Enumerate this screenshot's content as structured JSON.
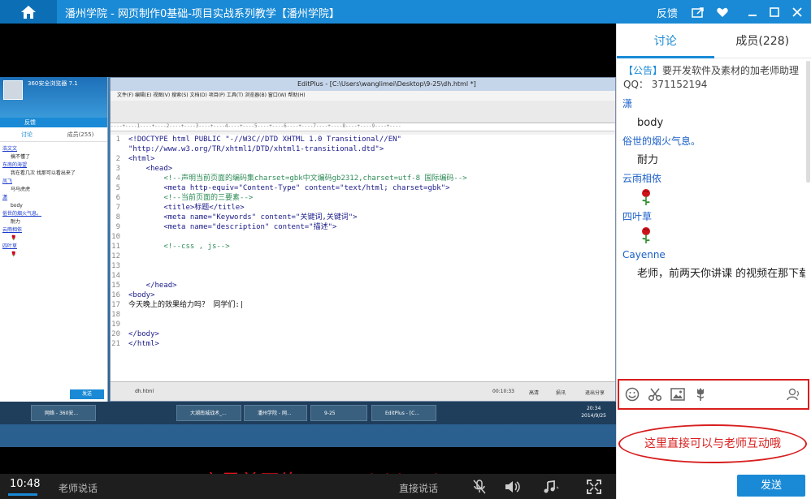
{
  "topbar": {
    "title": "潘州学院 - 网页制作0基础-项目实战系列教学【潘州学院】",
    "feedback": "反馈",
    "icons": [
      "home-icon",
      "share-icon",
      "heart-icon",
      "minimize-icon",
      "maximize-icon",
      "close-icon"
    ]
  },
  "video": {
    "caption": "亦是美网络 www.yishimei.cn",
    "inner": {
      "mini_chat": {
        "title": "360安全浏览器 7.1",
        "bar_label": "反馈",
        "tab_discuss": "讨论",
        "tab_members": "成员(255)",
        "lines": [
          {
            "u": "浩文文",
            "m": "搞不懂了"
          },
          {
            "u": "东南的海望",
            "m": "我在看几次 找那可以看出来了"
          },
          {
            "u": "凤飞",
            "m": "马马虎虎"
          },
          {
            "u": "潇",
            "m": "body"
          },
          {
            "u": "俗世的烟火气息。",
            "m": "耐力"
          },
          {
            "u": "云雨相依",
            "m": "🌹"
          },
          {
            "u": "四叶草",
            "m": "🌹"
          }
        ],
        "send": "发送"
      },
      "editplus": {
        "title": "EditPlus - [C:\\Users\\wanglimei\\Desktop\\9-25\\dh.html *]",
        "menu": "文件(F)  编辑(E)  视图(V)  搜索(S)  文档(D)  项目(P)  工具(T)  浏览器(B)  窗口(W)  帮助(H)",
        "ruler": "----+----1----+----2----+----3----+----4----+----5----+----6----+----7----+----8----+----9----+----",
        "code": [
          {
            "n": "1",
            "t": "<!DOCTYPE html PUBLIC \"-//W3C//DTD XHTML 1.0 Transitional//EN\"",
            "c": "tag"
          },
          {
            "n": "",
            "t": "\"http://www.w3.org/TR/xhtml1/DTD/xhtml1-transitional.dtd\">",
            "c": "tag"
          },
          {
            "n": "2",
            "t": "<html>",
            "c": "tag"
          },
          {
            "n": "3",
            "t": "    <head>",
            "c": "tag"
          },
          {
            "n": "4",
            "t": "        <!--声明当前页面的编码集charset=gbk中文编码gb2312,charset=utf-8 国际编码-->",
            "c": "cmt"
          },
          {
            "n": "5",
            "t": "        <meta http-equiv=\"Content-Type\" content=\"text/html; charset=gbk\">",
            "c": "tag"
          },
          {
            "n": "6",
            "t": "        <!--当前页面的三要素-->",
            "c": "cmt"
          },
          {
            "n": "7",
            "t": "        <title>标题</title>",
            "c": "tag"
          },
          {
            "n": "8",
            "t": "        <meta name=\"Keywords\" content=\"关键词,关键词\">",
            "c": "tag"
          },
          {
            "n": "9",
            "t": "        <meta name=\"description\" content=\"描述\">",
            "c": "tag"
          },
          {
            "n": "10",
            "t": "",
            "c": "plain"
          },
          {
            "n": "11",
            "t": "        <!--css , js-->",
            "c": "cmt"
          },
          {
            "n": "12",
            "t": "",
            "c": "plain"
          },
          {
            "n": "13",
            "t": "",
            "c": "plain"
          },
          {
            "n": "14",
            "t": "",
            "c": "plain"
          },
          {
            "n": "15",
            "t": "    </head>",
            "c": "tag"
          },
          {
            "n": "16",
            "t": "<body>",
            "c": "tag"
          },
          {
            "n": "",
            "t": "",
            "c": "plain"
          },
          {
            "n": "17",
            "t": "今天晚上的效果给力吗？ 同学们:|",
            "c": "plain"
          },
          {
            "n": "18",
            "t": "",
            "c": "plain"
          },
          {
            "n": "19",
            "t": "",
            "c": "plain"
          },
          {
            "n": "20",
            "t": "</body>",
            "c": "tag"
          },
          {
            "n": "21",
            "t": "</html>",
            "c": "tag"
          }
        ],
        "file_tab": "dh.html",
        "status": [
          "00:10:33",
          "高清",
          "损讯",
          "退出分享"
        ]
      },
      "taskbar": {
        "items": [
          "网络 - 360安...",
          "",
          "",
          "",
          "大湖南城战术_...",
          "潘州学院 - 网...",
          "9-25",
          "EditPlus - [C...",
          ""
        ],
        "clock_time": "20:34",
        "clock_date": "2014/9/25"
      }
    }
  },
  "controls": {
    "time": "10:48",
    "teacher": "老师说话",
    "live": "直接说话"
  },
  "panel": {
    "tab_discuss": "讨论",
    "tab_members": "成员(228)",
    "notice_label": "【公告】",
    "notice_text": "要开发软件及素材的加老师助理QQ：  371152194",
    "messages": [
      {
        "type": "user",
        "text": "潇"
      },
      {
        "type": "text",
        "text": "body"
      },
      {
        "type": "user",
        "text": "俗世的烟火气息。"
      },
      {
        "type": "text",
        "text": "耐力"
      },
      {
        "type": "user",
        "text": "云雨相依"
      },
      {
        "type": "flower"
      },
      {
        "type": "user",
        "text": "四叶草"
      },
      {
        "type": "flower"
      },
      {
        "type": "user",
        "text": "Cayenne"
      },
      {
        "type": "text",
        "text": "老师，前两天你讲课 的视频在那下载了"
      }
    ],
    "input_icons": [
      "emoji-icon",
      "scissors-icon",
      "image-icon",
      "flower-icon",
      "user-voice-icon"
    ],
    "hint": "这里直接可以与老师互动哦",
    "send": "发送"
  }
}
